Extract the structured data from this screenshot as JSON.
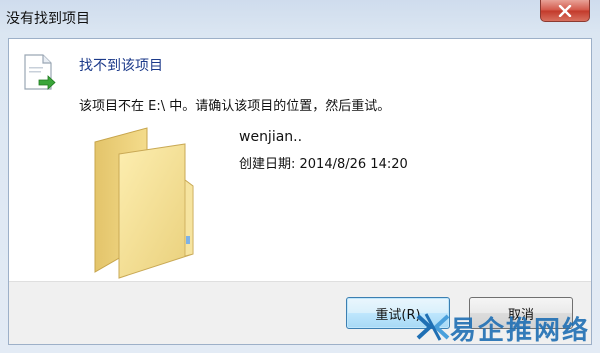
{
  "window": {
    "title": "没有找到项目"
  },
  "dialog": {
    "heading": "找不到该项目",
    "message": "该项目不在 E:\\ 中。请确认该项目的位置，然后重试。",
    "file": {
      "name": "wenjian..",
      "created_label": "创建日期: 2014/8/26 14:20"
    },
    "buttons": {
      "retry_label": "重试(R)",
      "cancel_label": "取消"
    }
  },
  "watermark": {
    "text": "易企推网络"
  },
  "icons": {
    "document": "document-arrow-icon",
    "folder": "folder-icon",
    "close": "close-icon",
    "logo": "watermark-logo-icon"
  },
  "colors": {
    "heading": "#1c3a8a",
    "close_button": "#c33a2b",
    "retry_highlight": "#bee6fd",
    "watermark": "#1f6fb4"
  }
}
